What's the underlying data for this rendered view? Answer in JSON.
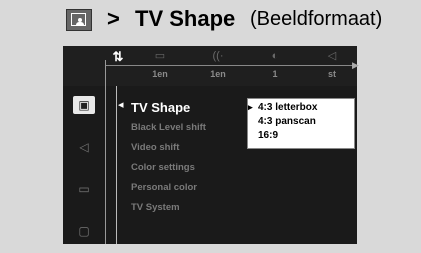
{
  "header": {
    "arrow": ">",
    "title": "TV Shape",
    "subtitle": "(Beeldformaat)",
    "icon": "tv-screen-icon"
  },
  "topbar": {
    "tabs": [
      {
        "icon": "settings-icon",
        "glyph": "⇅",
        "value": ""
      },
      {
        "icon": "subtitle-icon",
        "glyph": "▭",
        "value": "1en"
      },
      {
        "icon": "audio-language-icon",
        "glyph": "((·",
        "value": "1en"
      },
      {
        "icon": "angle-icon",
        "glyph": "◐",
        "value": "1"
      },
      {
        "icon": "sound-icon",
        "glyph": "◁",
        "value": "st"
      }
    ]
  },
  "sidebar": {
    "items": [
      {
        "icon": "tv-screen-icon",
        "glyph": "▣",
        "active": true
      },
      {
        "icon": "speaker-icon",
        "glyph": "◁",
        "active": false
      },
      {
        "icon": "chat-icon",
        "glyph": "▭",
        "active": false
      },
      {
        "icon": "briefcase-icon",
        "glyph": "▢",
        "active": false
      }
    ]
  },
  "menu": {
    "cursor": "◂",
    "items": [
      {
        "label": "TV Shape",
        "selected": true
      },
      {
        "label": "Black Level shift",
        "selected": false
      },
      {
        "label": "Video shift",
        "selected": false
      },
      {
        "label": "Color settings",
        "selected": false
      },
      {
        "label": "Personal color",
        "selected": false
      },
      {
        "label": "TV System",
        "selected": false
      }
    ]
  },
  "options": {
    "selected_marker": "▸",
    "items": [
      "4:3 letterbox",
      "4:3 panscan",
      "16:9"
    ]
  }
}
